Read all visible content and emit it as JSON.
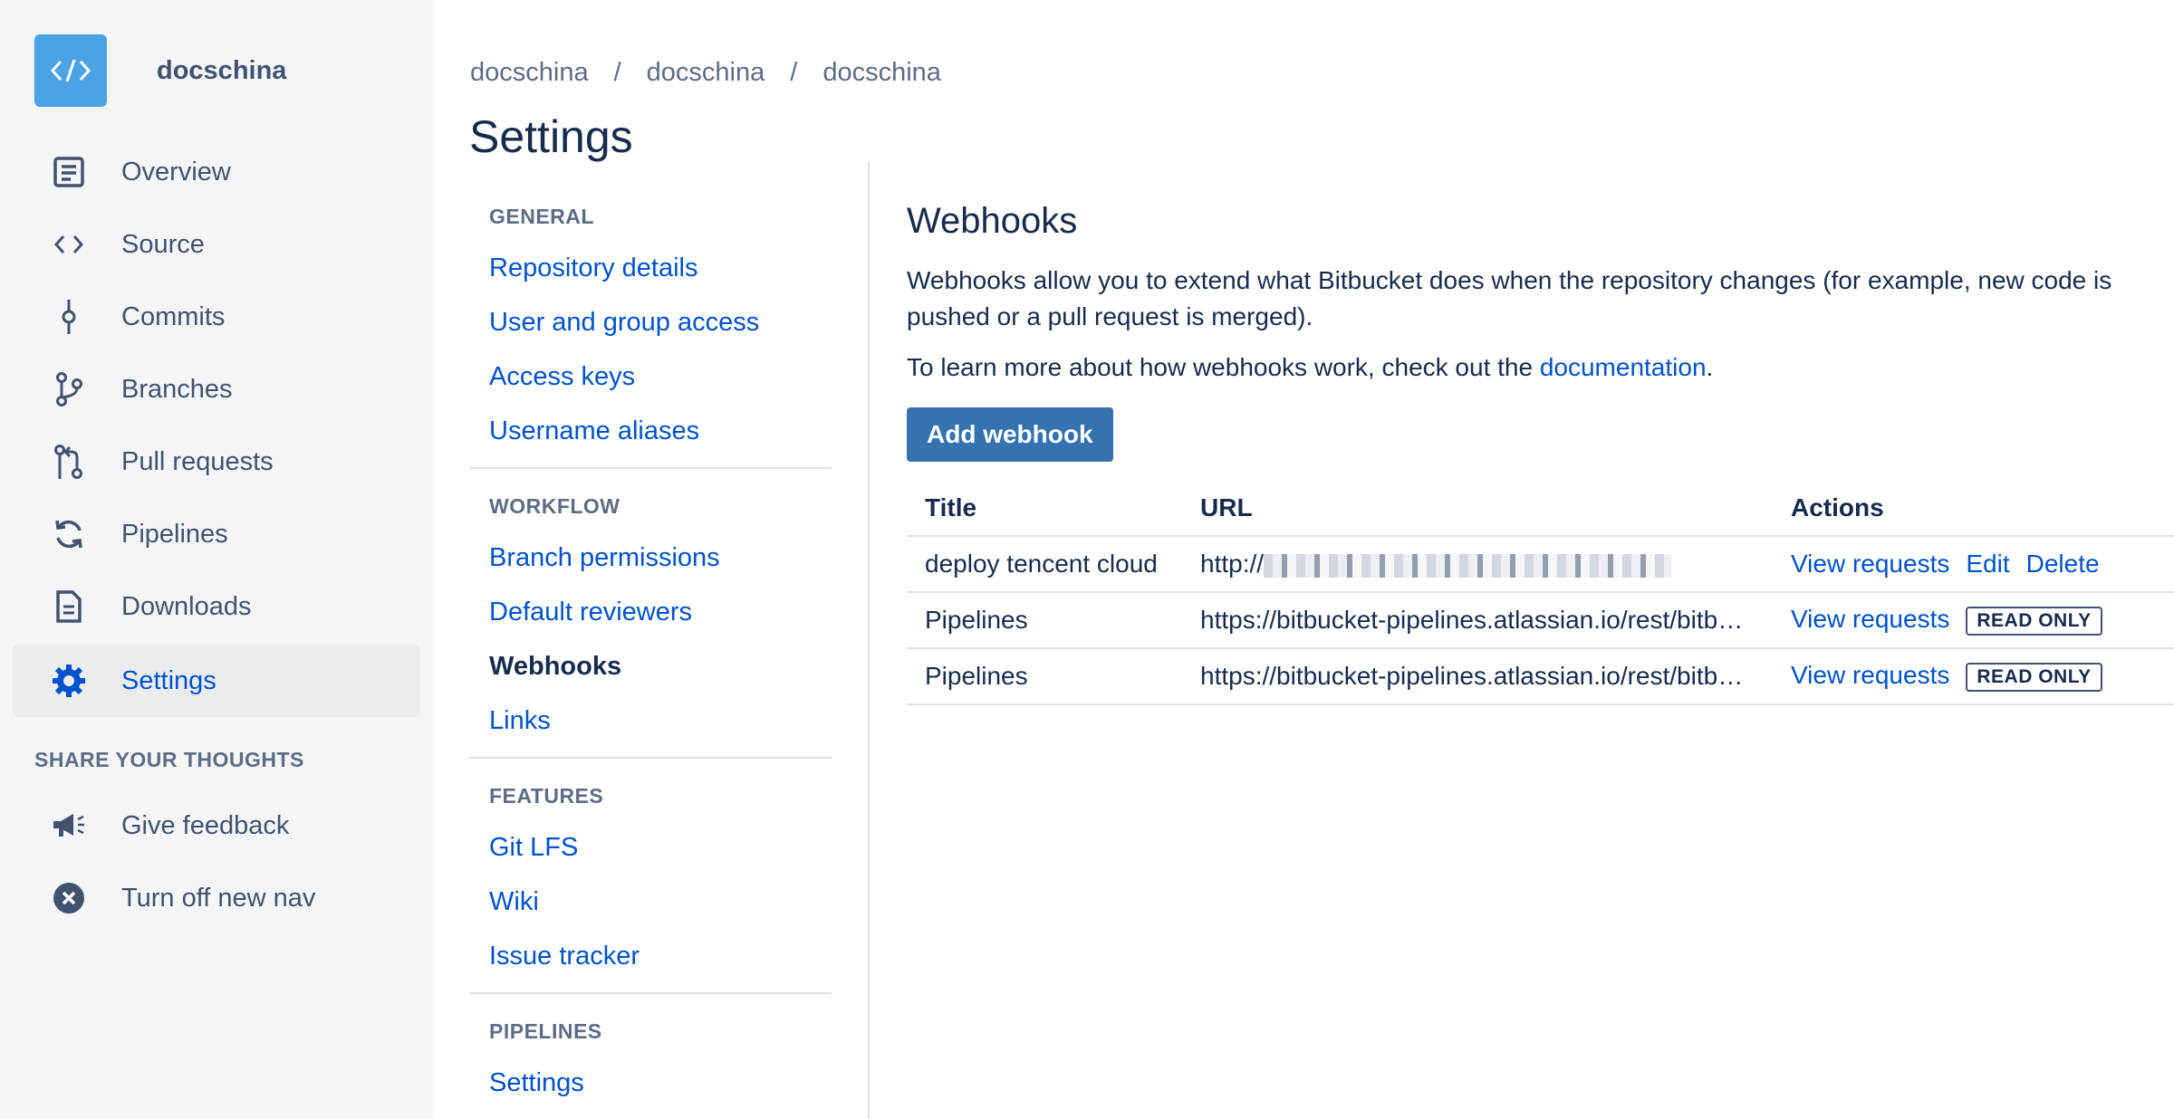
{
  "repo": {
    "name": "docschina"
  },
  "sidebar": {
    "items": [
      {
        "label": "Overview",
        "icon": "overview-icon"
      },
      {
        "label": "Source",
        "icon": "code-icon"
      },
      {
        "label": "Commits",
        "icon": "commit-icon"
      },
      {
        "label": "Branches",
        "icon": "branch-icon"
      },
      {
        "label": "Pull requests",
        "icon": "pull-request-icon"
      },
      {
        "label": "Pipelines",
        "icon": "pipelines-icon"
      },
      {
        "label": "Downloads",
        "icon": "document-icon"
      },
      {
        "label": "Settings",
        "icon": "gear-icon",
        "active": true
      }
    ],
    "share_title": "SHARE YOUR THOUGHTS",
    "share_items": [
      {
        "label": "Give feedback",
        "icon": "megaphone-icon"
      },
      {
        "label": "Turn off new nav",
        "icon": "close-circle-icon"
      }
    ]
  },
  "breadcrumb": [
    "docschina",
    "docschina",
    "docschina"
  ],
  "page_title": "Settings",
  "settings_nav": {
    "general": {
      "title": "GENERAL",
      "links": [
        "Repository details",
        "User and group access",
        "Access keys",
        "Username aliases"
      ]
    },
    "workflow": {
      "title": "WORKFLOW",
      "links": [
        "Branch permissions",
        "Default reviewers",
        "Webhooks",
        "Links"
      ],
      "current": "Webhooks"
    },
    "features": {
      "title": "FEATURES",
      "links": [
        "Git LFS",
        "Wiki",
        "Issue tracker"
      ]
    },
    "pipelines": {
      "title": "PIPELINES",
      "links": [
        "Settings"
      ]
    }
  },
  "webhooks": {
    "title": "Webhooks",
    "description": "Webhooks allow you to extend what Bitbucket does when the repository changes (for example, new code is pushed or a pull request is merged).",
    "learn_prefix": "To learn more about how webhooks work, check out the ",
    "learn_link": "documentation",
    "learn_suffix": ".",
    "add_button": "Add webhook",
    "columns": {
      "title": "Title",
      "url": "URL",
      "actions": "Actions"
    },
    "rows": [
      {
        "title": "deploy tencent cloud",
        "url": "http://",
        "url_obscured": true,
        "actions": [
          "View requests",
          "Edit",
          "Delete"
        ],
        "badge": ""
      },
      {
        "title": "Pipelines",
        "url": "https://bitbucket-pipelines.atlassian.io/rest/bitb…",
        "url_obscured": false,
        "actions": [
          "View requests"
        ],
        "badge": "READ ONLY"
      },
      {
        "title": "Pipelines",
        "url": "https://bitbucket-pipelines.atlassian.io/rest/bitb…",
        "url_obscured": false,
        "actions": [
          "View requests"
        ],
        "badge": "READ ONLY"
      }
    ]
  },
  "colors": {
    "accent": "#0052cc",
    "button": "#3572b0",
    "sidebar_bg": "#f4f5f7",
    "repo_avatar": "#4ba3e3"
  }
}
